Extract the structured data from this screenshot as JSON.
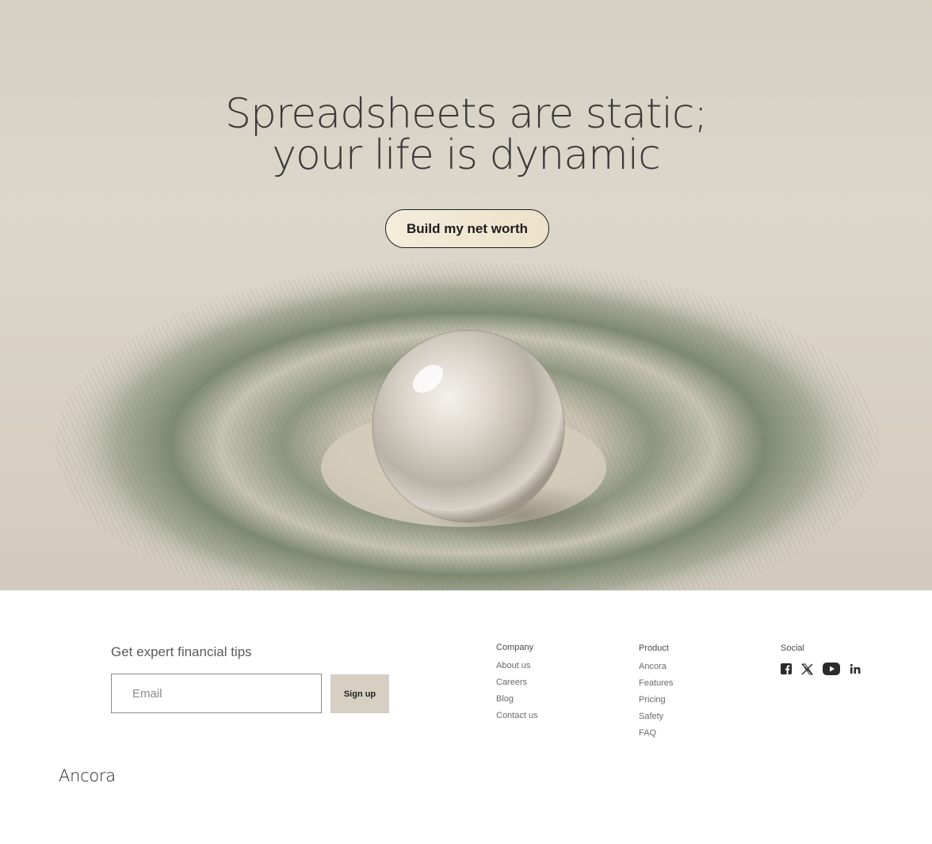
{
  "hero": {
    "headline_line1": "Spreadsheets are static;",
    "headline_line2": "your life is dynamic",
    "cta_label": "Build my net worth"
  },
  "newsletter": {
    "title": "Get expert financial tips",
    "email_placeholder": "Email",
    "signup_label": "Sign up"
  },
  "footer": {
    "company": {
      "heading": "Company",
      "links": [
        "About us",
        "Careers",
        "Blog",
        "Contact us"
      ]
    },
    "product": {
      "heading": "Product",
      "links": [
        "Ancora",
        "Features",
        "Pricing",
        "Safety",
        "FAQ"
      ]
    },
    "social": {
      "heading": "Social",
      "icons": [
        "facebook-icon",
        "x-icon",
        "youtube-icon",
        "linkedin-icon"
      ]
    }
  },
  "brand": {
    "name": "Ancora"
  },
  "colors": {
    "hero_background": "#d8d1c4",
    "sand_green": "#7f8a72",
    "cta_fill": "#f2e9d6",
    "signup_fill": "#d6cfc2"
  }
}
